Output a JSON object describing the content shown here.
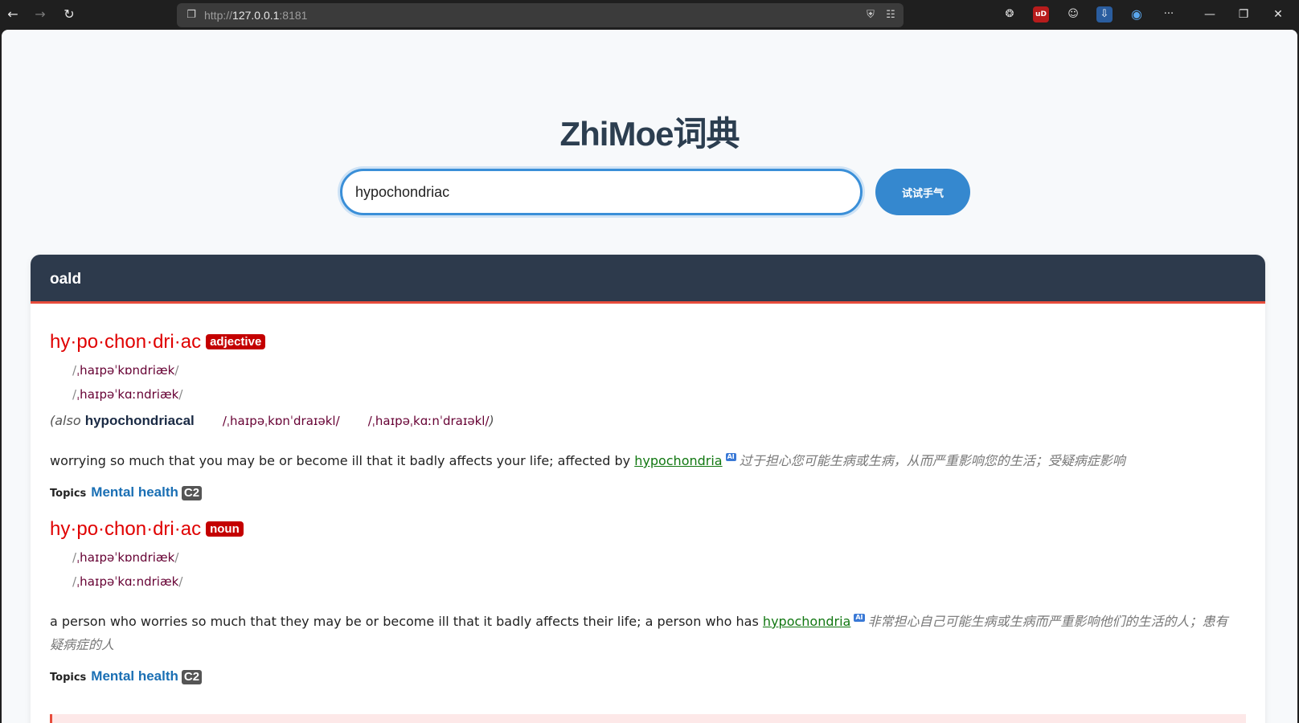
{
  "browser": {
    "url_scheme": "http://",
    "url_host": "127.0.0.1",
    "url_port": ":8181",
    "back_icon": "←",
    "forward_icon": "→",
    "reload_icon": "↻",
    "page_icon": "❐",
    "shield_icon": "⛨",
    "reader_icon": "☷",
    "extension_icons": [
      "❂",
      "uD",
      "☺",
      "⇩",
      "◉"
    ],
    "more_icon": "···",
    "min_icon": "—",
    "restore_icon": "❐",
    "close_icon": "✕"
  },
  "site": {
    "title": "ZhiMoe词典",
    "search_value": "hypochondriac",
    "search_button": "试试手气"
  },
  "card": {
    "dict_name": "oald",
    "entries": [
      {
        "headword": "hy·po·chon·dri·ac",
        "pos": "adjective",
        "phon_br": "ˌhaɪpəˈkɒndriæk",
        "phon_us": "ˌhaɪpəˈkɑːndriæk",
        "also_open": "(also",
        "also_word": "hypochondriacal",
        "also_phon1": "ˌhaɪpəˌkɒnˈdraɪəkl",
        "also_phon2": "ˌhaɪpəˌkɑːnˈdraɪəkl",
        "also_close": ")",
        "def_text": "worrying so much that you may be or become ill that it badly affects your life; affected by",
        "def_link": "hypochondria",
        "ai_label": "AI",
        "def_cn": "过于担心您可能生病或生病，从而严重影响您的生活；受疑病症影响",
        "topics_label": "Topics",
        "topic": "Mental health",
        "level": "C2"
      },
      {
        "headword": "hy·po·chon·dri·ac",
        "pos": "noun",
        "phon_br": "ˌhaɪpəˈkɒndriæk",
        "phon_us": "ˌhaɪpəˈkɑːndriæk",
        "def_text": "a person who worries so much that they may be or become ill that it badly affects their life; a person who has",
        "def_link": "hypochondria",
        "ai_label": "AI",
        "def_cn": "非常担心自己可能生病或生病而严重影响他们的生活的人；患有疑病症的人",
        "topics_label": "Topics",
        "topic": "Mental health",
        "level": "C2"
      }
    ]
  }
}
